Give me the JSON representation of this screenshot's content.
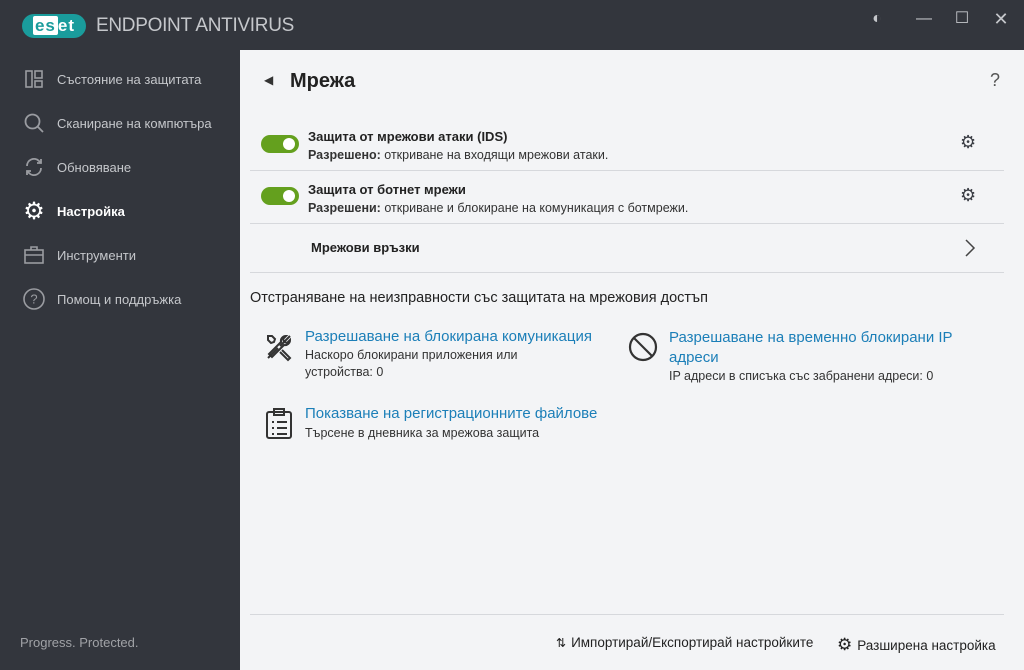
{
  "app": {
    "logo": "eset",
    "product": "ENDPOINT ANTIVIRUS",
    "tagline": "Progress. Protected."
  },
  "window": {
    "contrast_icon": "contrast-icon",
    "minimize": "minimize-icon",
    "maximize": "maximize-icon",
    "close": "close-icon"
  },
  "sidebar": {
    "items": [
      {
        "label": "Състояние на защитата",
        "icon": "dashboard-icon"
      },
      {
        "label": "Сканиране на компютъра",
        "icon": "search-icon"
      },
      {
        "label": "Обновяване",
        "icon": "refresh-icon"
      },
      {
        "label": "Настройка",
        "icon": "gear-icon",
        "active": true
      },
      {
        "label": "Инструменти",
        "icon": "toolbox-icon"
      },
      {
        "label": "Помощ и поддръжка",
        "icon": "help-icon"
      }
    ]
  },
  "page": {
    "title": "Мрежа",
    "help": "?"
  },
  "settings": [
    {
      "title": "Защита от мрежови атаки (IDS)",
      "status": "Разрешено:",
      "description": " откриване на входящи мрежови атаки.",
      "enabled": true
    },
    {
      "title": "Защита от ботнет мрежи",
      "status": "Разрешени:",
      "description": " откриване и блокиране на комуникация с ботмрежи.",
      "enabled": true
    }
  ],
  "network_connections": "Мрежови връзки",
  "troubleshoot": {
    "heading": "Отстраняване на неизправности със защитата на мрежовия достъп",
    "items": [
      {
        "title": "Разрешаване на блокирана комуникация",
        "desc1": "Наскоро блокирани приложения или",
        "desc2": "устройства: 0"
      },
      {
        "title1": "Разрешаване на временно блокирани IP",
        "title2": "адреси",
        "desc": "IP адреси в списъка със забранени адреси: 0"
      },
      {
        "title": "Показване на регистрационните файлове",
        "desc": "Търсене в дневника за мрежова защита"
      }
    ]
  },
  "footer": {
    "import_export": "Импортирай/Експортирай настройките",
    "advanced": "Разширена настройка"
  },
  "colors": {
    "accent": "#1c7fb8",
    "toggle": "#64a01e",
    "sidebar": "#33363d",
    "main": "#f3f4f6"
  }
}
